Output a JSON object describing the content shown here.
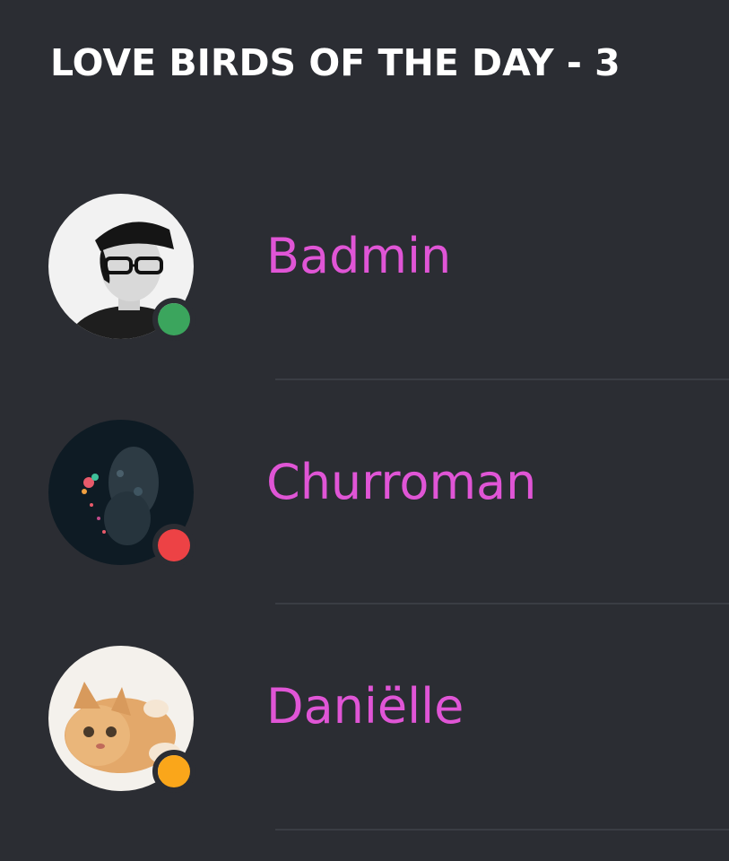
{
  "section": {
    "title": "LOVE BIRDS OF THE DAY - 3"
  },
  "members": [
    {
      "name": "Badmin",
      "name_color": "#e055d6",
      "status": "online",
      "status_color": "#3ba55d",
      "avatar": "man-with-cap-glasses-avatar"
    },
    {
      "name": "Churroman",
      "name_color": "#e055d6",
      "status": "do-not-disturb",
      "status_color": "#ed4245",
      "avatar": "dark-colorful-figure-avatar"
    },
    {
      "name": "Daniëlle",
      "name_color": "#e055d6",
      "status": "idle",
      "status_color": "#faa61a",
      "avatar": "orange-kitten-avatar"
    }
  ]
}
